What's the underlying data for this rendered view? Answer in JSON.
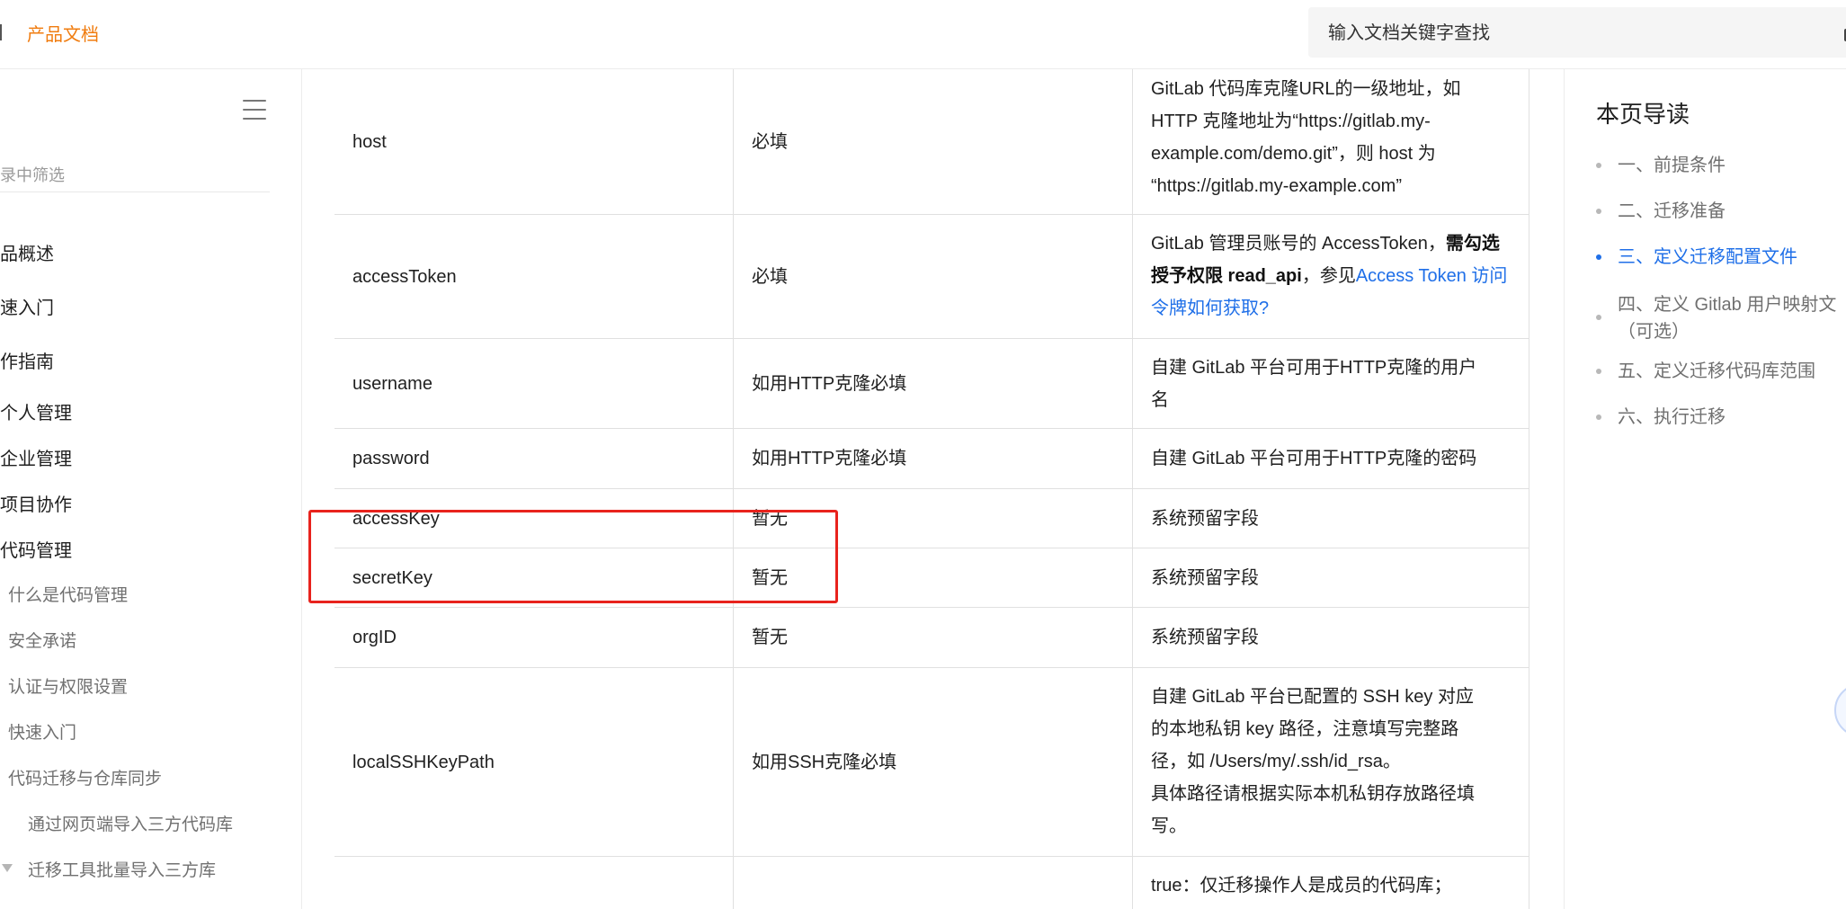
{
  "header": {
    "brand": "产品文档",
    "search_placeholder": "输入文档关键字查找"
  },
  "sidebar": {
    "filter_text": "录中筛选",
    "items": [
      {
        "label": "品概述"
      },
      {
        "label": "速入门"
      },
      {
        "label": "作指南"
      },
      {
        "label": "个人管理"
      },
      {
        "label": "企业管理"
      },
      {
        "label": "项目协作"
      },
      {
        "label": "代码管理"
      },
      {
        "label": "什么是代码管理"
      },
      {
        "label": "安全承诺"
      },
      {
        "label": "认证与权限设置"
      },
      {
        "label": "快速入门"
      },
      {
        "label": "代码迁移与仓库同步"
      },
      {
        "label": "通过网页端导入三方代码库"
      },
      {
        "label": "迁移工具批量导入三方库"
      }
    ]
  },
  "table": {
    "rows": [
      {
        "name": "host",
        "required": "必填",
        "desc_lines": [
          "GitLab 代码库克隆URL的一级地址，如",
          "HTTP 克隆地址为“https://gitlab.my-",
          "example.com/demo.git”，则 host 为",
          "“https://gitlab.my-example.com”"
        ]
      },
      {
        "name": "accessToken",
        "required": "必填",
        "desc_prefix": "GitLab 管理员账号的 AccessToken，",
        "desc_bold": "需勾选授予权限 read_api",
        "desc_mid": "，参见",
        "desc_link": "Access Token 访问令牌如何获取?"
      },
      {
        "name": "username",
        "required": "如用HTTP克隆必填",
        "desc_lines": [
          "自建 GitLab 平台可用于HTTP克隆的用户",
          "名"
        ]
      },
      {
        "name": "password",
        "required": "如用HTTP克隆必填",
        "desc": "自建 GitLab 平台可用于HTTP克隆的密码"
      },
      {
        "name": "accessKey",
        "required": "暂无",
        "desc": "系统预留字段"
      },
      {
        "name": "secretKey",
        "required": "暂无",
        "desc": "系统预留字段"
      },
      {
        "name": "orgID",
        "required": "暂无",
        "desc": "系统预留字段"
      },
      {
        "name": "localSSHKeyPath",
        "required": "如用SSH克隆必填",
        "desc_lines": [
          "自建 GitLab 平台已配置的 SSH key 对应",
          "的本地私钥 key 路径，注意填写完整路",
          "径，如 /Users/my/.ssh/id_rsa。",
          "具体路径请根据实际本机私钥存放路径填",
          "写。"
        ]
      },
      {
        "name": "",
        "required": "",
        "desc": "true：仅迁移操作人是成员的代码库；"
      }
    ]
  },
  "toc": {
    "title": "本页导读",
    "items": [
      {
        "label": "一、前提条件",
        "active": false
      },
      {
        "label": "二、迁移准备",
        "active": false
      },
      {
        "label": "三、定义迁移配置文件",
        "active": true
      },
      {
        "label": "四、定义 Gitlab 用户映射文",
        "label2": "（可选）",
        "active": false
      },
      {
        "label": "五、定义迁移代码库范围",
        "active": false
      },
      {
        "label": "六、执行迁移",
        "active": false
      }
    ]
  },
  "colors": {
    "brand": "#f07c0f",
    "link": "#1f6fe8",
    "highlight_box": "#e8231d"
  }
}
